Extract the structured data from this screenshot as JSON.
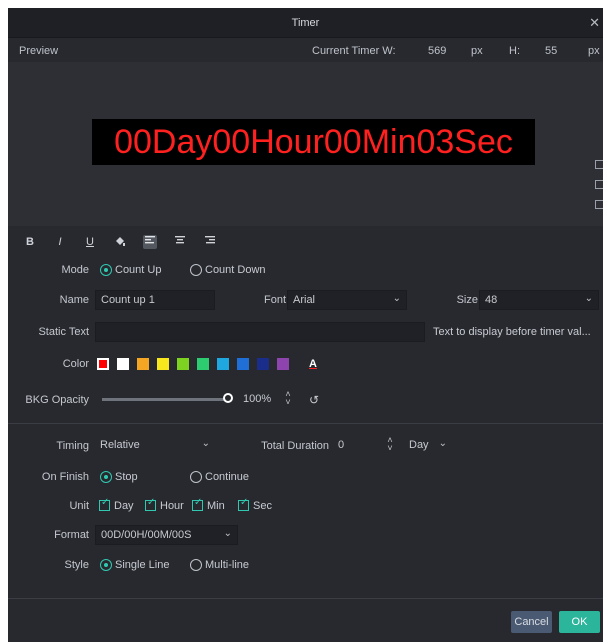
{
  "window": {
    "title": "Timer",
    "close_icon": "x-icon"
  },
  "preview": {
    "label": "Preview",
    "current_w_label": "Current Timer W:",
    "width_value": "569",
    "width_unit": "px",
    "h_label": "H:",
    "height_value": "55",
    "height_unit": "px",
    "timer_text": "00Day00Hour00Min03Sec",
    "timer_color": "#ff2020"
  },
  "toolbar": {
    "bold": "B",
    "italic": "I",
    "underline": "U",
    "fill_icon": "paint-bucket-icon",
    "align_left_icon": "align-left-icon",
    "align_center_icon": "align-center-icon",
    "align_right_icon": "align-right-icon"
  },
  "mode": {
    "label": "Mode",
    "options": [
      "Count Up",
      "Count Down"
    ],
    "selected": "Count Up"
  },
  "name": {
    "label": "Name",
    "value": "Count up 1"
  },
  "font": {
    "label": "Font",
    "value": "Arial"
  },
  "size": {
    "label": "Size",
    "value": "48"
  },
  "static_text": {
    "label": "Static Text",
    "value": "",
    "hint": "Text to display before timer val..."
  },
  "color": {
    "label": "Color",
    "swatches": [
      "#ff0000",
      "#ffffff",
      "#f5a623",
      "#f8e71c",
      "#7ed321",
      "#2ecc71",
      "#1fa8e0",
      "#1f6fd6",
      "#1b2d8a",
      "#8e44ad"
    ],
    "selected": "#ff0000",
    "text_color_glyph": "A"
  },
  "bkg_opacity": {
    "label": "BKG Opacity",
    "value": "100%",
    "level": 1.0
  },
  "timing": {
    "label": "Timing",
    "value": "Relative"
  },
  "total_duration": {
    "label": "Total Duration",
    "value": "0",
    "unit": "Day"
  },
  "on_finish": {
    "label": "On Finish",
    "options": [
      "Stop",
      "Continue"
    ],
    "selected": "Stop"
  },
  "unit": {
    "label": "Unit",
    "options": [
      "Day",
      "Hour",
      "Min",
      "Sec"
    ]
  },
  "format": {
    "label": "Format",
    "value": "00D/00H/00M/00S"
  },
  "style": {
    "label": "Style",
    "options": [
      "Single Line",
      "Multi-line"
    ],
    "selected": "Single Line"
  },
  "buttons": {
    "cancel": "Cancel",
    "ok": "OK"
  }
}
